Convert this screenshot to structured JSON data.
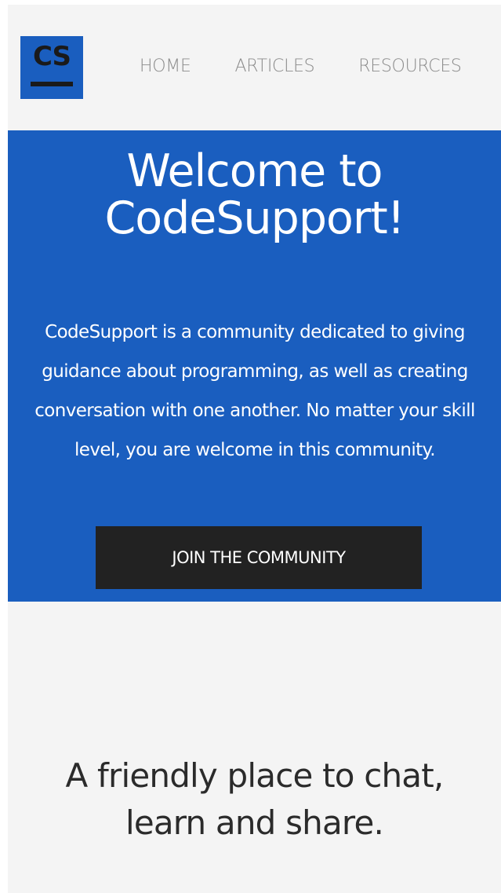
{
  "header": {
    "logo_text": "CS",
    "nav": [
      {
        "label": "HOME"
      },
      {
        "label": "ARTICLES"
      },
      {
        "label": "RESOURCES"
      }
    ]
  },
  "hero": {
    "title_line1": "Welcome to",
    "title_line2": "CodeSupport!",
    "description": "CodeSupport is a community dedicated to giving guidance about programming, as well as creating conversation with one another. No matter your skill level, you are welcome in this community.",
    "cta_label": "JOIN THE COMMUNITY"
  },
  "section2": {
    "title_line1": "A friendly place to chat,",
    "title_line2": "learn and share."
  },
  "colors": {
    "brand_blue": "#1a5ebf",
    "button_dark": "#222222",
    "page_background": "#f4f4f4",
    "nav_text": "#8c8c8c"
  }
}
